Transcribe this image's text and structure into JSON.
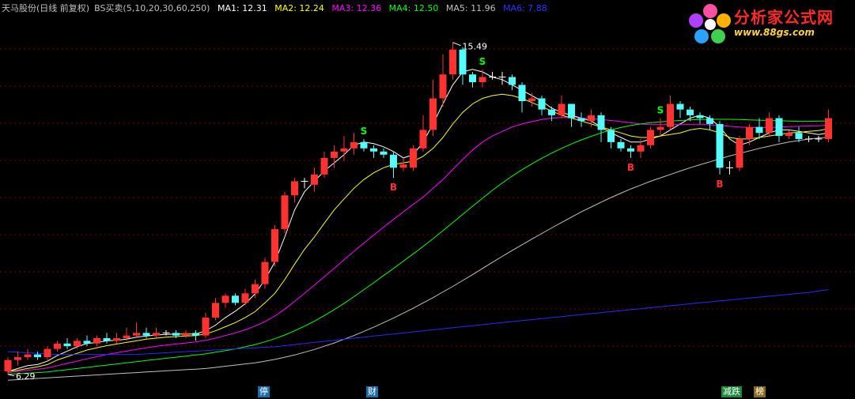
{
  "header": {
    "title": "天马股份(日线 前复权)",
    "indicator": "BS买卖(5,10,20,30,60,250)",
    "ma": [
      {
        "label": "MA1: 12.31",
        "color": "#ffffff"
      },
      {
        "label": "MA2: 12.24",
        "color": "#ffff00"
      },
      {
        "label": "MA3: 12.36",
        "color": "#ff00ff"
      },
      {
        "label": "MA4: 12.50",
        "color": "#00ff00"
      },
      {
        "label": "MA5: 11.96",
        "color": "#c0c0c0"
      },
      {
        "label": "MA6: 7.88",
        "color": "#3030ff"
      }
    ]
  },
  "logo": {
    "cn": "分析家公式网",
    "url": "www.88gs.com"
  },
  "bottom_markers": [
    {
      "text": "停",
      "bg": "#1a6fa8"
    },
    {
      "text": "财",
      "bg": "#1a6fa8"
    },
    {
      "text": "减跌",
      "bg": "#1a8a3a"
    },
    {
      "text": "榜",
      "bg": "#8a6a1a"
    }
  ],
  "chart_data": {
    "type": "candlestick",
    "y_scale": "log",
    "ylim": [
      6.1,
      16.6
    ],
    "high_label": "15.49",
    "low_label": "6.29",
    "colors": {
      "up": "#ff3232",
      "down": "#54fcfc",
      "flat": "#ffffff"
    },
    "candles": [
      [
        6.3,
        6.5,
        6.25,
        6.55
      ],
      [
        6.5,
        6.55,
        6.4,
        6.65
      ],
      [
        6.55,
        6.6,
        6.5,
        6.7
      ],
      [
        6.6,
        6.55,
        6.5,
        6.65
      ],
      [
        6.55,
        6.7,
        6.5,
        6.75
      ],
      [
        6.7,
        6.8,
        6.65,
        6.85
      ],
      [
        6.8,
        6.75,
        6.7,
        6.9
      ],
      [
        6.75,
        6.85,
        6.7,
        6.9
      ],
      [
        6.85,
        6.8,
        6.75,
        6.95
      ],
      [
        6.8,
        6.9,
        6.75,
        6.95
      ],
      [
        6.9,
        6.85,
        6.8,
        7.0
      ],
      [
        6.85,
        6.9,
        6.8,
        7.0
      ],
      [
        6.9,
        6.95,
        6.85,
        7.1
      ],
      [
        6.95,
        7.0,
        6.9,
        7.2
      ],
      [
        7.0,
        6.95,
        6.9,
        7.1
      ],
      [
        6.95,
        7.0,
        6.9,
        7.1
      ],
      [
        7.0,
        7.0,
        6.95,
        7.05
      ],
      [
        7.0,
        6.95,
        6.9,
        7.05
      ],
      [
        6.95,
        7.0,
        6.9,
        7.05
      ],
      [
        7.0,
        6.95,
        6.85,
        7.05
      ],
      [
        6.95,
        7.3,
        6.9,
        7.4
      ],
      [
        7.3,
        7.6,
        7.25,
        7.7
      ],
      [
        7.6,
        7.75,
        7.5,
        7.8
      ],
      [
        7.75,
        7.6,
        7.55,
        7.8
      ],
      [
        7.6,
        7.8,
        7.55,
        7.9
      ],
      [
        7.8,
        8.0,
        7.7,
        8.1
      ],
      [
        8.0,
        8.5,
        7.9,
        8.6
      ],
      [
        8.5,
        9.3,
        8.4,
        9.4
      ],
      [
        9.3,
        10.2,
        9.2,
        10.3
      ],
      [
        10.2,
        10.6,
        10.0,
        10.7
      ],
      [
        10.6,
        10.6,
        10.4,
        10.7
      ],
      [
        10.5,
        10.8,
        10.3,
        11.0
      ],
      [
        10.8,
        11.3,
        10.7,
        11.5
      ],
      [
        11.3,
        11.5,
        11.0,
        11.7
      ],
      [
        11.5,
        11.6,
        11.2,
        12.0
      ],
      [
        11.6,
        11.8,
        11.4,
        12.1
      ],
      [
        11.8,
        11.6,
        11.5,
        11.9
      ],
      [
        11.6,
        11.5,
        11.3,
        11.7
      ],
      [
        11.5,
        11.4,
        11.3,
        11.6
      ],
      [
        11.4,
        11.0,
        10.7,
        11.5
      ],
      [
        11.0,
        11.1,
        10.9,
        11.3
      ],
      [
        11.0,
        11.6,
        10.9,
        11.7
      ],
      [
        11.6,
        12.2,
        11.5,
        12.7
      ],
      [
        12.2,
        13.3,
        12.0,
        14.0
      ],
      [
        13.3,
        14.2,
        13.0,
        15.0
      ],
      [
        14.2,
        15.2,
        14.0,
        15.5
      ],
      [
        15.2,
        14.2,
        13.8,
        15.3
      ],
      [
        14.2,
        13.9,
        13.7,
        14.3
      ],
      [
        13.9,
        14.1,
        13.7,
        14.4
      ],
      [
        14.1,
        14.1,
        14.0,
        14.3
      ],
      [
        14.1,
        14.1,
        13.8,
        14.3
      ],
      [
        14.1,
        13.8,
        13.6,
        14.2
      ],
      [
        13.8,
        13.2,
        12.8,
        13.9
      ],
      [
        13.2,
        13.3,
        13.0,
        13.5
      ],
      [
        13.3,
        12.9,
        12.7,
        13.4
      ],
      [
        12.9,
        12.7,
        12.5,
        13.0
      ],
      [
        12.7,
        13.1,
        12.6,
        13.4
      ],
      [
        13.1,
        12.6,
        12.3,
        13.1
      ],
      [
        12.6,
        12.5,
        12.3,
        12.8
      ],
      [
        12.5,
        12.7,
        12.3,
        12.9
      ],
      [
        12.7,
        12.2,
        11.8,
        12.8
      ],
      [
        12.2,
        11.8,
        11.6,
        12.3
      ],
      [
        11.8,
        11.6,
        11.5,
        11.9
      ],
      [
        11.6,
        11.5,
        11.3,
        11.7
      ],
      [
        11.5,
        11.7,
        11.3,
        11.9
      ],
      [
        11.7,
        12.2,
        11.6,
        12.3
      ],
      [
        12.2,
        12.3,
        12.0,
        12.6
      ],
      [
        12.3,
        13.1,
        12.2,
        13.4
      ],
      [
        13.1,
        12.9,
        12.6,
        13.2
      ],
      [
        12.9,
        12.7,
        12.5,
        13.0
      ],
      [
        12.7,
        12.6,
        12.4,
        12.8
      ],
      [
        12.6,
        12.4,
        12.2,
        12.7
      ],
      [
        12.4,
        11.0,
        10.8,
        12.5
      ],
      [
        11.0,
        11.0,
        10.8,
        11.2
      ],
      [
        11.0,
        11.9,
        10.9,
        12.0
      ],
      [
        11.9,
        12.3,
        11.7,
        12.4
      ],
      [
        12.3,
        12.1,
        11.9,
        12.6
      ],
      [
        12.1,
        12.6,
        12.0,
        12.8
      ],
      [
        12.6,
        12.0,
        11.8,
        12.7
      ],
      [
        12.0,
        12.1,
        11.9,
        12.2
      ],
      [
        12.1,
        11.9,
        11.8,
        12.3
      ],
      [
        11.9,
        11.9,
        11.8,
        12.0
      ],
      [
        11.9,
        11.9,
        11.8,
        12.0
      ],
      [
        11.9,
        12.6,
        11.8,
        12.9
      ]
    ],
    "signals": [
      {
        "candle": 36,
        "type": "S"
      },
      {
        "candle": 39,
        "type": "B"
      },
      {
        "candle": 48,
        "type": "S"
      },
      {
        "candle": 63,
        "type": "B"
      },
      {
        "candle": 66,
        "type": "S"
      },
      {
        "candle": 72,
        "type": "B"
      }
    ],
    "ma_series": [
      {
        "name": "MA1",
        "color": "#ffffff",
        "values": [
          6.3,
          6.35,
          6.4,
          6.42,
          6.48,
          6.58,
          6.66,
          6.74,
          6.8,
          6.82,
          6.85,
          6.86,
          6.88,
          6.92,
          6.94,
          6.96,
          6.97,
          6.98,
          6.98,
          6.98,
          7.04,
          7.15,
          7.3,
          7.43,
          7.58,
          7.79,
          8.1,
          8.5,
          9.1,
          9.8,
          10.3,
          10.6,
          10.9,
          11.15,
          11.4,
          11.7,
          11.8,
          11.75,
          11.65,
          11.5,
          11.3,
          11.4,
          11.8,
          12.4,
          13.1,
          13.8,
          14.3,
          14.4,
          14.3,
          14.1,
          14.0,
          13.8,
          13.6,
          13.4,
          13.2,
          12.95,
          12.8,
          12.7,
          12.6,
          12.5,
          12.3,
          12.1,
          11.95,
          11.8,
          11.8,
          11.9,
          12.0,
          12.2,
          12.4,
          12.6,
          12.7,
          12.6,
          12.3,
          11.9,
          11.7,
          11.8,
          11.95,
          12.1,
          12.2,
          12.2,
          12.15,
          12.1,
          12.05,
          12.1
        ]
      },
      {
        "name": "MA2",
        "color": "#ffff00",
        "values": [
          6.3,
          6.32,
          6.35,
          6.38,
          6.42,
          6.5,
          6.56,
          6.62,
          6.68,
          6.72,
          6.76,
          6.79,
          6.82,
          6.85,
          6.88,
          6.9,
          6.92,
          6.93,
          6.94,
          6.95,
          6.98,
          7.04,
          7.12,
          7.2,
          7.3,
          7.42,
          7.6,
          7.8,
          8.1,
          8.45,
          8.8,
          9.1,
          9.45,
          9.8,
          10.1,
          10.4,
          10.65,
          10.85,
          11.0,
          11.1,
          11.15,
          11.2,
          11.35,
          11.6,
          11.95,
          12.4,
          12.8,
          13.1,
          13.3,
          13.4,
          13.45,
          13.4,
          13.3,
          13.15,
          13.0,
          12.85,
          12.7,
          12.6,
          12.5,
          12.4,
          12.3,
          12.2,
          12.1,
          12.0,
          11.95,
          11.95,
          12.0,
          12.05,
          12.1,
          12.2,
          12.25,
          12.2,
          12.1,
          11.95,
          11.9,
          11.9,
          11.95,
          12.0,
          12.05,
          12.1,
          12.12,
          12.15,
          12.18,
          12.24
        ]
      },
      {
        "name": "MA3",
        "color": "#ff00ff",
        "values": [
          6.28,
          6.3,
          6.32,
          6.34,
          6.36,
          6.4,
          6.44,
          6.48,
          6.52,
          6.56,
          6.6,
          6.63,
          6.66,
          6.69,
          6.72,
          6.75,
          6.77,
          6.79,
          6.81,
          6.83,
          6.86,
          6.9,
          6.95,
          7.0,
          7.06,
          7.13,
          7.22,
          7.33,
          7.47,
          7.63,
          7.8,
          7.98,
          8.16,
          8.35,
          8.55,
          8.75,
          8.95,
          9.15,
          9.35,
          9.55,
          9.75,
          9.95,
          10.15,
          10.4,
          10.65,
          10.95,
          11.25,
          11.55,
          11.8,
          12.0,
          12.15,
          12.3,
          12.4,
          12.48,
          12.55,
          12.6,
          12.62,
          12.62,
          12.6,
          12.58,
          12.55,
          12.52,
          12.48,
          12.44,
          12.4,
          12.38,
          12.38,
          12.38,
          12.38,
          12.38,
          12.38,
          12.37,
          12.35,
          12.32,
          12.3,
          12.28,
          12.28,
          12.28,
          12.3,
          12.31,
          12.32,
          12.33,
          12.34,
          12.36
        ]
      },
      {
        "name": "MA4",
        "color": "#00ff00",
        "values": [
          6.25,
          6.26,
          6.27,
          6.28,
          6.29,
          6.31,
          6.33,
          6.35,
          6.37,
          6.39,
          6.41,
          6.43,
          6.45,
          6.47,
          6.49,
          6.51,
          6.53,
          6.55,
          6.57,
          6.59,
          6.61,
          6.64,
          6.67,
          6.7,
          6.74,
          6.78,
          6.83,
          6.89,
          6.96,
          7.04,
          7.13,
          7.23,
          7.34,
          7.46,
          7.59,
          7.73,
          7.88,
          8.03,
          8.19,
          8.35,
          8.52,
          8.69,
          8.87,
          9.06,
          9.26,
          9.47,
          9.68,
          9.9,
          10.12,
          10.34,
          10.55,
          10.75,
          10.94,
          11.12,
          11.29,
          11.45,
          11.6,
          11.74,
          11.87,
          11.99,
          12.1,
          12.2,
          12.28,
          12.35,
          12.4,
          12.44,
          12.47,
          12.5,
          12.52,
          12.54,
          12.55,
          12.56,
          12.56,
          12.56,
          12.55,
          12.54,
          12.53,
          12.52,
          12.51,
          12.5,
          12.49,
          12.49,
          12.5,
          12.5
        ]
      },
      {
        "name": "MA5",
        "color": "#c0c0c0",
        "values": [
          6.15,
          6.16,
          6.17,
          6.18,
          6.19,
          6.2,
          6.21,
          6.22,
          6.23,
          6.24,
          6.25,
          6.26,
          6.27,
          6.28,
          6.29,
          6.3,
          6.31,
          6.32,
          6.33,
          6.34,
          6.35,
          6.37,
          6.39,
          6.41,
          6.43,
          6.45,
          6.48,
          6.51,
          6.55,
          6.59,
          6.64,
          6.69,
          6.75,
          6.81,
          6.88,
          6.95,
          7.03,
          7.11,
          7.2,
          7.29,
          7.39,
          7.49,
          7.6,
          7.71,
          7.83,
          7.95,
          8.08,
          8.21,
          8.35,
          8.49,
          8.63,
          8.77,
          8.91,
          9.05,
          9.19,
          9.33,
          9.47,
          9.61,
          9.75,
          9.88,
          10.01,
          10.14,
          10.26,
          10.38,
          10.49,
          10.6,
          10.7,
          10.8,
          10.9,
          11.0,
          11.09,
          11.18,
          11.27,
          11.36,
          11.44,
          11.52,
          11.6,
          11.67,
          11.74,
          11.8,
          11.85,
          11.9,
          11.93,
          11.96
        ]
      },
      {
        "name": "MA6",
        "color": "#2a2aff",
        "values": [
          6.65,
          6.64,
          6.63,
          6.62,
          6.61,
          6.6,
          6.6,
          6.6,
          6.6,
          6.6,
          6.6,
          6.6,
          6.6,
          6.6,
          6.61,
          6.62,
          6.63,
          6.64,
          6.65,
          6.66,
          6.67,
          6.68,
          6.69,
          6.7,
          6.71,
          6.72,
          6.73,
          6.74,
          6.76,
          6.78,
          6.8,
          6.82,
          6.84,
          6.86,
          6.88,
          6.9,
          6.92,
          6.94,
          6.96,
          6.98,
          7.0,
          7.02,
          7.04,
          7.06,
          7.08,
          7.1,
          7.12,
          7.14,
          7.16,
          7.18,
          7.2,
          7.22,
          7.24,
          7.26,
          7.28,
          7.3,
          7.32,
          7.34,
          7.36,
          7.38,
          7.4,
          7.42,
          7.44,
          7.46,
          7.48,
          7.5,
          7.52,
          7.54,
          7.56,
          7.58,
          7.6,
          7.62,
          7.64,
          7.66,
          7.68,
          7.7,
          7.72,
          7.74,
          7.76,
          7.78,
          7.8,
          7.82,
          7.85,
          7.88
        ]
      }
    ]
  }
}
